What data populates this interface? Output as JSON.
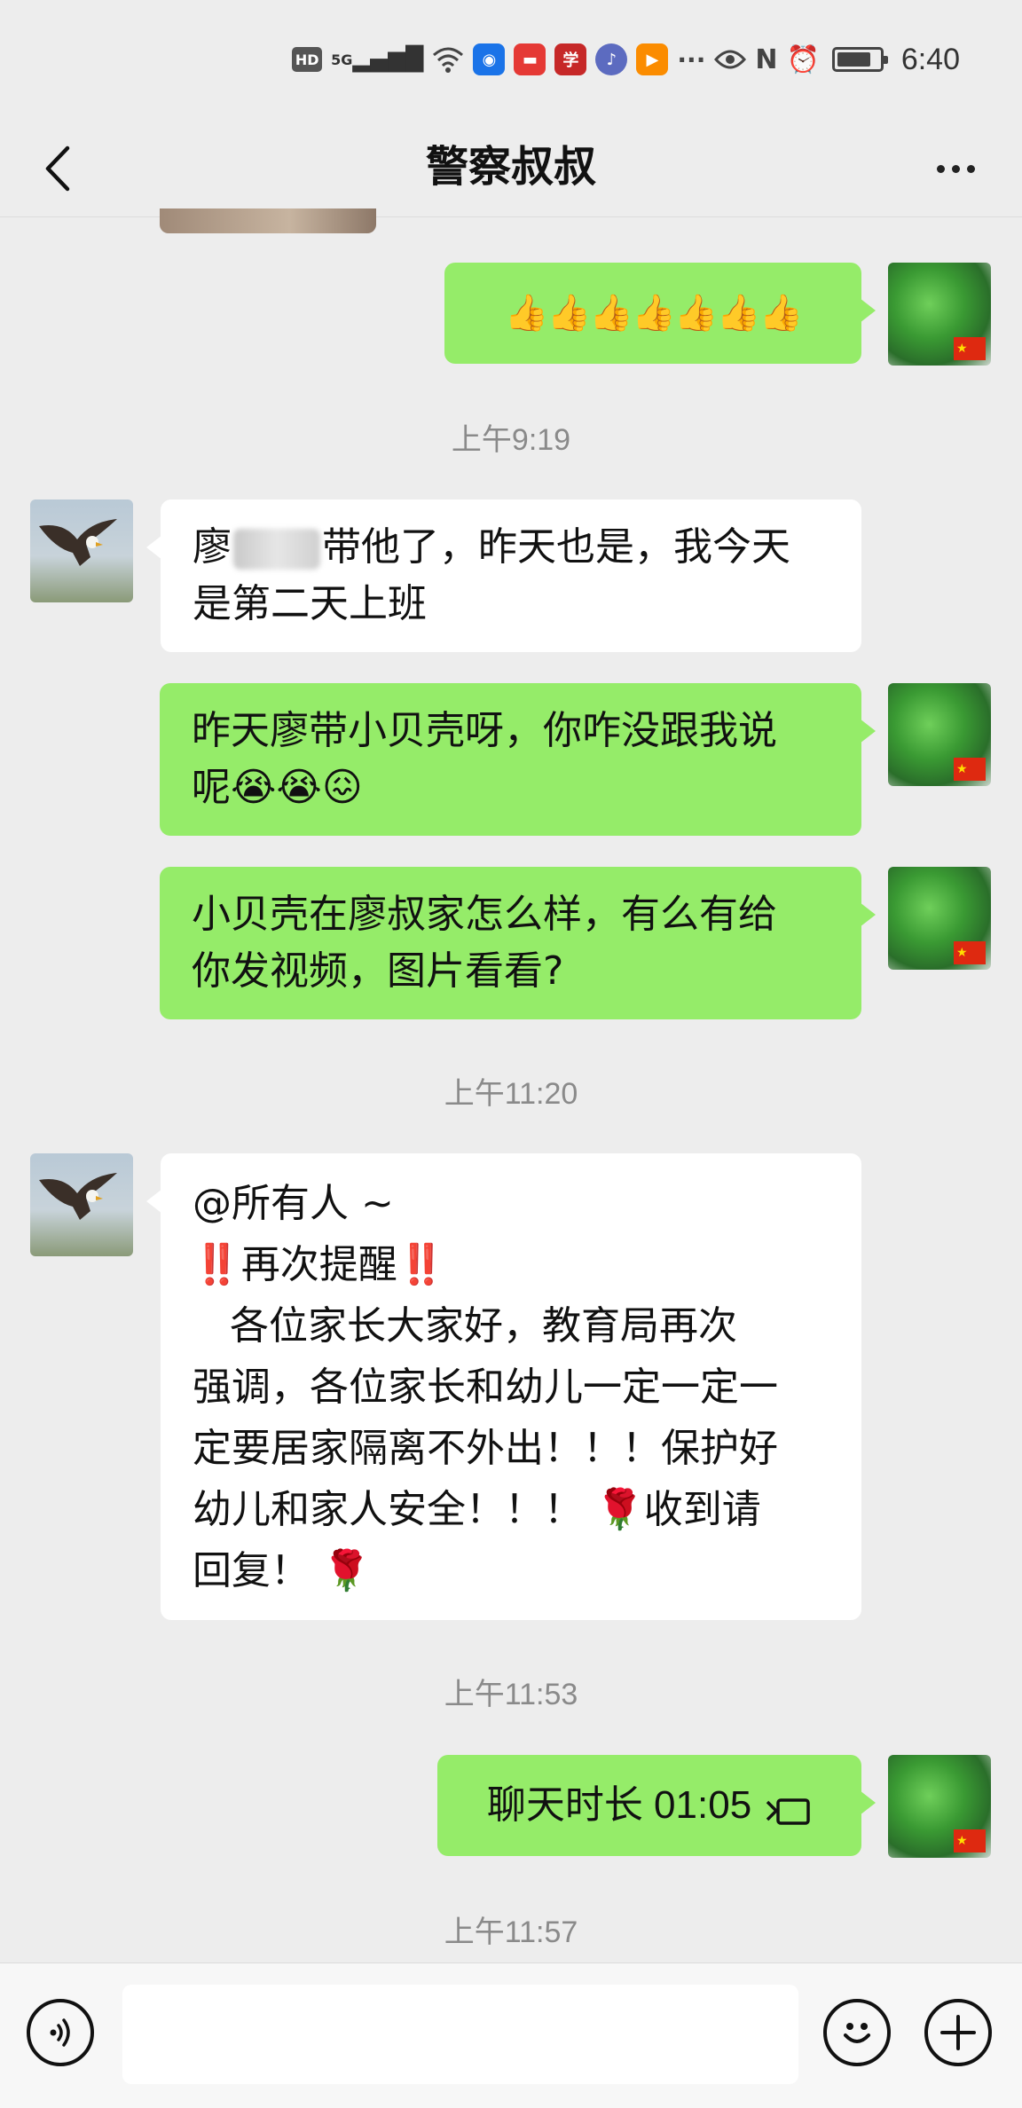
{
  "status_bar": {
    "hd": "HD",
    "network": "5G",
    "dots": "···",
    "time": "6:40",
    "battery_level": 0.8
  },
  "header": {
    "title": "警察叔叔",
    "back_icon": "chevron-left-icon",
    "more_icon": "more-horizontal-icon"
  },
  "messages": [
    {
      "side": "right",
      "type": "emoji",
      "text": "👍👍👍👍👍👍👍"
    },
    {
      "type": "time",
      "text": "上午9:19"
    },
    {
      "side": "left",
      "type": "text",
      "text_before": "廖",
      "text_after": "带他了，昨天也是，我今天\n是第二天上班"
    },
    {
      "side": "right",
      "type": "text",
      "text": "昨天廖带小贝壳呀，你咋没跟我说\n呢😭😭😖"
    },
    {
      "side": "right",
      "type": "text",
      "text": "小贝壳在廖叔家怎么样，有么有给\n你发视频，图片看看?"
    },
    {
      "type": "time",
      "text": "上午11:20"
    },
    {
      "side": "left",
      "type": "text",
      "text": "@所有人 ~\n‼️再次提醒‼️\n   各位家长大家好，教育局再次\n强调，各位家长和幼儿一定一定一\n定要居家隔离不外出！！！保护好\n幼儿和家人安全！！！ 🌹收到请\n回复！ 🌹"
    },
    {
      "type": "time",
      "text": "上午11:53"
    },
    {
      "side": "right",
      "type": "call",
      "text": "聊天时长 01:05"
    },
    {
      "type": "time",
      "text": "上午11:57"
    }
  ],
  "input_bar": {
    "voice_icon": "voice-icon",
    "placeholder": "",
    "emoji_icon": "emoji-icon",
    "plus_icon": "plus-icon"
  },
  "colors": {
    "background": "#ededed",
    "self_bubble": "#95ec69",
    "other_bubble": "#ffffff",
    "time_text": "#8a8a8a"
  }
}
